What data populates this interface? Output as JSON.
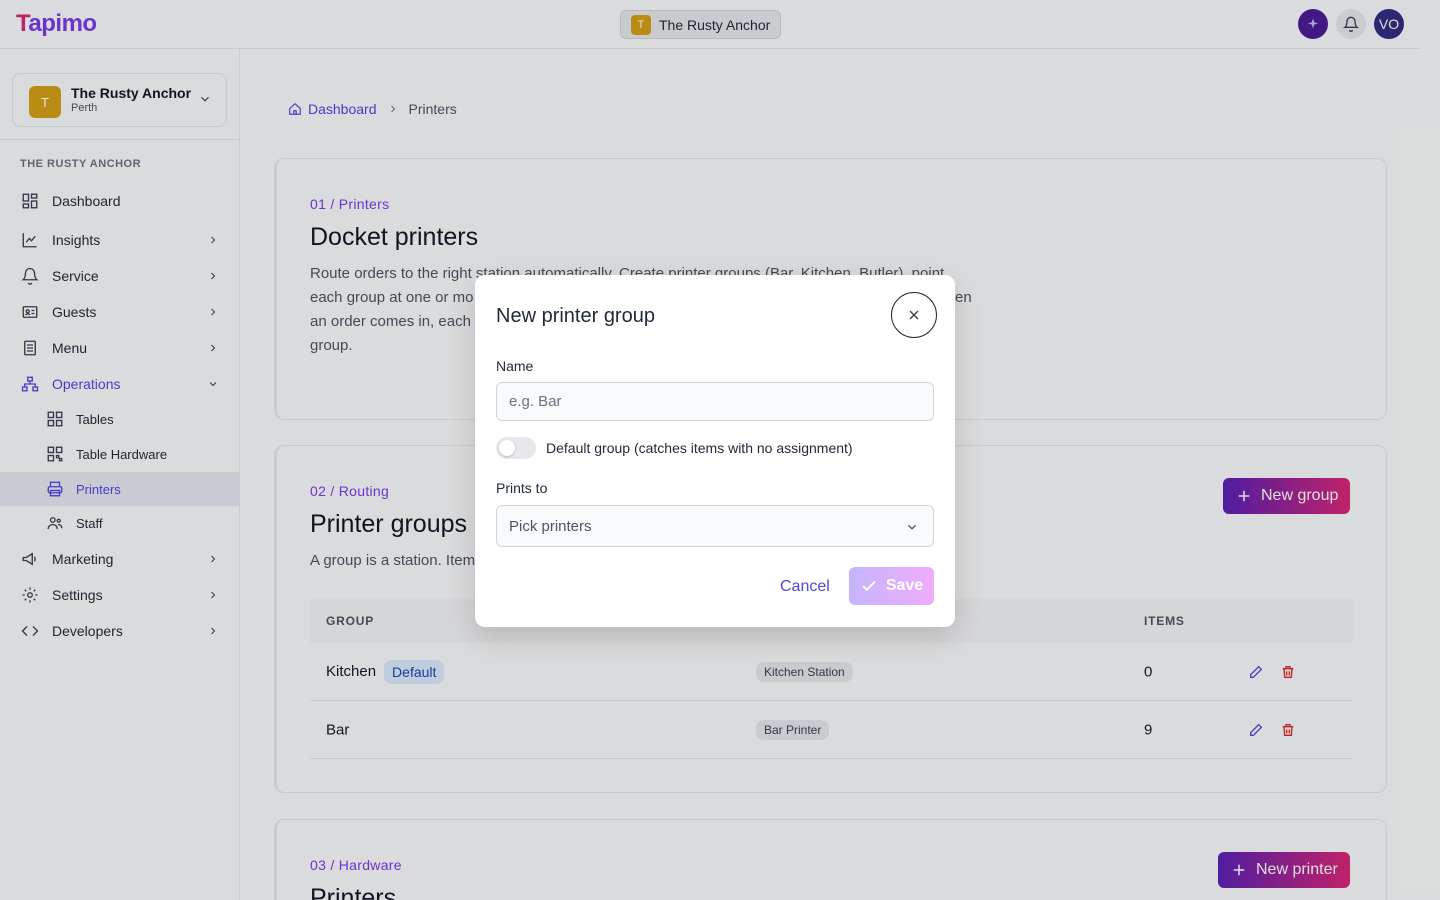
{
  "topbar": {
    "logo_mark": "T",
    "logo_rest": "apimo",
    "venue_initial": "T",
    "venue_name": "The Rusty Anchor",
    "avatar": "VO"
  },
  "sidebar": {
    "venue_initial": "T",
    "venue_name": "The Rusty Anchor",
    "venue_location": "Perth",
    "section_title": "THE RUSTY ANCHOR",
    "items": [
      {
        "label": "Dashboard",
        "icon": "dashboard-icon"
      },
      {
        "label": "Insights",
        "icon": "chart-line-icon"
      },
      {
        "label": "Service",
        "icon": "bell-icon"
      },
      {
        "label": "Guests",
        "icon": "id-card-icon"
      },
      {
        "label": "Menu",
        "icon": "document-icon"
      },
      {
        "label": "Operations",
        "icon": "network-icon"
      },
      {
        "label": "Tables",
        "icon": "grid-icon"
      },
      {
        "label": "Table Hardware",
        "icon": "qr-icon"
      },
      {
        "label": "Printers",
        "icon": "printer-icon"
      },
      {
        "label": "Staff",
        "icon": "users-icon"
      },
      {
        "label": "Marketing",
        "icon": "megaphone-icon"
      },
      {
        "label": "Settings",
        "icon": "gear-icon"
      },
      {
        "label": "Developers",
        "icon": "code-icon"
      }
    ]
  },
  "breadcrumb": {
    "home": "Dashboard",
    "current": "Printers"
  },
  "section1": {
    "kicker": "01 / Printers",
    "title": "Docket printers",
    "desc_line1": "Route orders to the right station automatically. Create printer groups (Bar, Kitchen, Butler), point",
    "desc_line2": "each group at one or mo",
    "desc_line2b": "en",
    "desc_line3": "an order comes in, each",
    "desc_line4": "group."
  },
  "section2": {
    "kicker": "02 / Routing",
    "title": "Printer groups",
    "desc": "A group is a station. Item",
    "new_group": "New group",
    "columns": {
      "group": "GROUP",
      "items": "ITEMS"
    },
    "rows": [
      {
        "name": "Kitchen",
        "badge": "Default",
        "printer": "Kitchen Station",
        "items": "0"
      },
      {
        "name": "Bar",
        "badge": "",
        "printer": "Bar Printer",
        "items": "9"
      }
    ]
  },
  "section3": {
    "kicker": "03 / Hardware",
    "title": "Printers",
    "new_printer": "New printer"
  },
  "modal": {
    "title": "New printer group",
    "name_label": "Name",
    "name_placeholder": "e.g. Bar",
    "name_value": "",
    "default_toggle_label": "Default group (catches items with no assignment)",
    "prints_to_label": "Prints to",
    "prints_to_placeholder": "Pick printers",
    "cancel": "Cancel",
    "save": "Save"
  },
  "colors": {
    "accent": "#4f46e5",
    "brand": "#7c3aed",
    "danger": "#dc2626"
  }
}
